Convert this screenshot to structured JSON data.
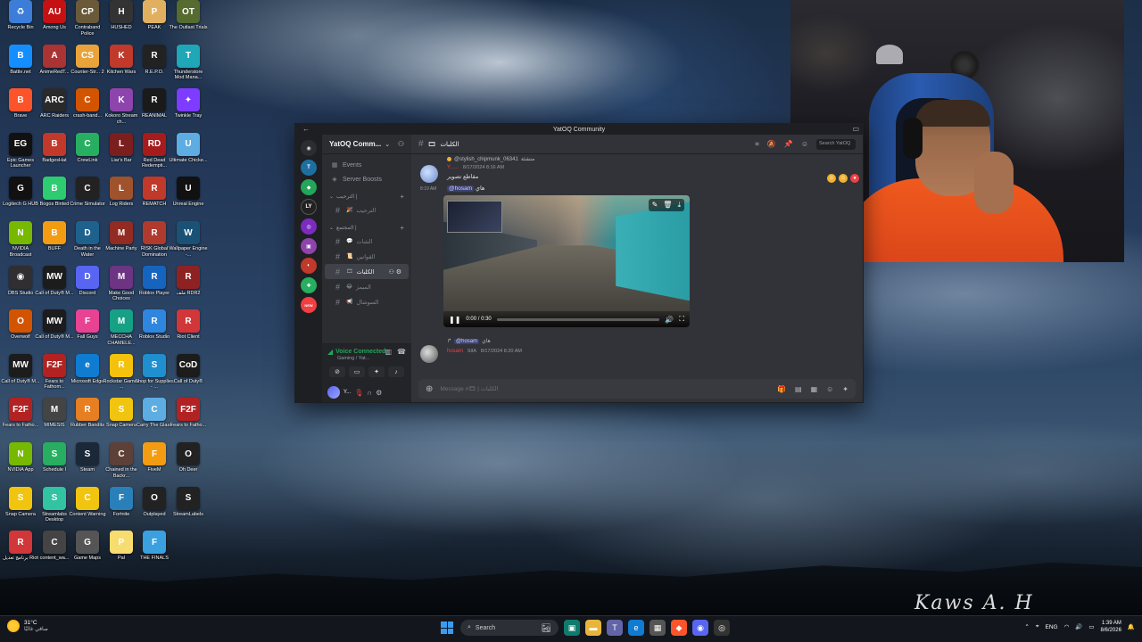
{
  "desktop": {
    "icons": [
      {
        "label": "Recycle Bin",
        "glyph": "♻",
        "color": "#3b7dd8"
      },
      {
        "label": "Among Us",
        "glyph": "AU",
        "color": "#c51111"
      },
      {
        "label": "Contraband Police",
        "glyph": "CP",
        "color": "#6b5a3a"
      },
      {
        "label": "HUSHED",
        "glyph": "H",
        "color": "#333333"
      },
      {
        "label": "PEAK",
        "glyph": "P",
        "color": "#e0b060"
      },
      {
        "label": "The Outlast Trials",
        "glyph": "OT",
        "color": "#556b2f"
      },
      {
        "label": "Battle.net",
        "glyph": "B",
        "color": "#148eff"
      },
      {
        "label": "AnimeRedT...",
        "glyph": "A",
        "color": "#aa3333"
      },
      {
        "label": "Counter-Str... 2",
        "glyph": "CS",
        "color": "#e8a33b"
      },
      {
        "label": "Kitchen Wars",
        "glyph": "K",
        "color": "#c0392b"
      },
      {
        "label": "R.E.P.O.",
        "glyph": "R",
        "color": "#222222"
      },
      {
        "label": "Thunderstore Mod Mana...",
        "glyph": "T",
        "color": "#1fa7b8"
      },
      {
        "label": "Brave",
        "glyph": "B",
        "color": "#fb542b"
      },
      {
        "label": "ARC Raiders",
        "glyph": "ARC",
        "color": "#2a2a2a"
      },
      {
        "label": "crash-band...",
        "glyph": "C",
        "color": "#d35400"
      },
      {
        "label": "Kokoro Stream ch...",
        "glyph": "K",
        "color": "#8e44ad"
      },
      {
        "label": "REANIMAL",
        "glyph": "R",
        "color": "#1a1a1a"
      },
      {
        "label": "Twinkle Tray",
        "glyph": "✦",
        "color": "#7d3cff"
      },
      {
        "label": "Epic Games Launcher",
        "glyph": "EG",
        "color": "#111111"
      },
      {
        "label": "BadgesHat",
        "glyph": "B",
        "color": "#c0392b"
      },
      {
        "label": "CrewLink",
        "glyph": "C",
        "color": "#27ae60"
      },
      {
        "label": "Liar's Bar",
        "glyph": "L",
        "color": "#7b1e1e"
      },
      {
        "label": "Red Dead Redempti...",
        "glyph": "RD",
        "color": "#a61b1b"
      },
      {
        "label": "Ultimate Chicke...",
        "glyph": "U",
        "color": "#5dade2"
      },
      {
        "label": "Logitech G HUB",
        "glyph": "G",
        "color": "#111111"
      },
      {
        "label": "Bogos Binted",
        "glyph": "B",
        "color": "#2ecc71"
      },
      {
        "label": "Crime Simulator",
        "glyph": "C",
        "color": "#222222"
      },
      {
        "label": "Log Riders",
        "glyph": "L",
        "color": "#a0522d"
      },
      {
        "label": "REMATCH",
        "glyph": "R",
        "color": "#c0392b"
      },
      {
        "label": "Unreal Engine",
        "glyph": "U",
        "color": "#111111"
      },
      {
        "label": "NVIDIA Broadcast",
        "glyph": "N",
        "color": "#76b900"
      },
      {
        "label": "BUFF",
        "glyph": "B",
        "color": "#f39c12"
      },
      {
        "label": "Death in the Water",
        "glyph": "D",
        "color": "#1f618d"
      },
      {
        "label": "Machine Party",
        "glyph": "M",
        "color": "#922b21"
      },
      {
        "label": "RISK Global Domination",
        "glyph": "R",
        "color": "#b03a2e"
      },
      {
        "label": "Wallpaper Engine -...",
        "glyph": "W",
        "color": "#1a5276"
      },
      {
        "label": "OBS Studio",
        "glyph": "◉",
        "color": "#302e31"
      },
      {
        "label": "Call of Duty® M...",
        "glyph": "MW",
        "color": "#1c1c1c"
      },
      {
        "label": "Discord",
        "glyph": "D",
        "color": "#5865f2"
      },
      {
        "label": "Make Good Choices",
        "glyph": "M",
        "color": "#6c3483"
      },
      {
        "label": "Roblox Player",
        "glyph": "R",
        "color": "#1565c0"
      },
      {
        "label": "ملف RDR2",
        "glyph": "R",
        "color": "#8e2222"
      },
      {
        "label": "Overwolf",
        "glyph": "O",
        "color": "#d35400"
      },
      {
        "label": "Call of Duty® M...",
        "glyph": "MW",
        "color": "#1c1c1c"
      },
      {
        "label": "Fall Guys",
        "glyph": "F",
        "color": "#e84393"
      },
      {
        "label": "MECCHA CHAMELE...",
        "glyph": "M",
        "color": "#16a085"
      },
      {
        "label": "Roblox Studio",
        "glyph": "R",
        "color": "#2e86de"
      },
      {
        "label": "Riot Client",
        "glyph": "R",
        "color": "#d13639"
      },
      {
        "label": "Call of Duty® M...",
        "glyph": "MW",
        "color": "#1c1c1c"
      },
      {
        "label": "Fears to Fathom...",
        "glyph": "F2F",
        "color": "#b22222"
      },
      {
        "label": "Microsoft Edge",
        "glyph": "e",
        "color": "#0f7bd1"
      },
      {
        "label": "Rockstar Games ...",
        "glyph": "R",
        "color": "#f4c20d"
      },
      {
        "label": "Shop for Supplies - ...",
        "glyph": "S",
        "color": "#1f8fcf"
      },
      {
        "label": "Call of Duty®",
        "glyph": "CoD",
        "color": "#1c1c1c"
      },
      {
        "label": "Fears to Fatho...",
        "glyph": "F2F",
        "color": "#b22222"
      },
      {
        "label": "MIMESIS",
        "glyph": "M",
        "color": "#444444"
      },
      {
        "label": "Rubber Bandits",
        "glyph": "R",
        "color": "#e67e22"
      },
      {
        "label": "Snap Camera",
        "glyph": "S",
        "color": "#f1c40f"
      },
      {
        "label": "Carry The Glass",
        "glyph": "C",
        "color": "#5dade2"
      },
      {
        "label": "Fears to Fatho...",
        "glyph": "F2F",
        "color": "#b22222"
      },
      {
        "label": "NVIDIA App",
        "glyph": "N",
        "color": "#76b900"
      },
      {
        "label": "Schedule I",
        "glyph": "S",
        "color": "#27ae60"
      },
      {
        "label": "Steam",
        "glyph": "S",
        "color": "#1b2838"
      },
      {
        "label": "Chained in the Backr...",
        "glyph": "C",
        "color": "#5d4037"
      },
      {
        "label": "FiveM",
        "glyph": "F",
        "color": "#f39c12"
      },
      {
        "label": "Oh Deer",
        "glyph": "O",
        "color": "#222222"
      },
      {
        "label": "Snap Camera",
        "glyph": "S",
        "color": "#f1c40f"
      },
      {
        "label": "Streamlabs Desktop",
        "glyph": "S",
        "color": "#31c3a2"
      },
      {
        "label": "Content Warning",
        "glyph": "C",
        "color": "#f1c40f"
      },
      {
        "label": "Fortnite",
        "glyph": "F",
        "color": "#2980b9"
      },
      {
        "label": "Outplayed",
        "glyph": "O",
        "color": "#222222"
      },
      {
        "label": "StreamLabels",
        "glyph": "S",
        "color": "#222222"
      },
      {
        "label": "برنامج تعديل Riot",
        "glyph": "R",
        "color": "#d13639"
      },
      {
        "label": "content_wa...",
        "glyph": "C",
        "color": "#444444"
      },
      {
        "label": "Game Maps",
        "glyph": "G",
        "color": "#555555"
      },
      {
        "label": "Pal",
        "glyph": "P",
        "color": "#f7dc6f"
      },
      {
        "label": "THE FINALS",
        "glyph": "F",
        "color": "#3aa0e0"
      }
    ],
    "signature": "Kaws A. H"
  },
  "discord": {
    "window_title": "YatOQ Community",
    "server_name": "YatOQ Comm...",
    "events_label": "Events",
    "boosts_label": "Server Boosts",
    "categories": [
      {
        "label": "الترحيب |"
      },
      {
        "label": "المجتمع |"
      }
    ],
    "pre_channels": [
      {
        "emoji": "🎉",
        "name": "الترحيب"
      }
    ],
    "channels": [
      {
        "emoji": "💬",
        "name": "الشات",
        "active": false
      },
      {
        "emoji": "📜",
        "name": "القوانين",
        "active": false
      },
      {
        "emoji": "🎞",
        "name": "الكلبات",
        "active": true
      },
      {
        "emoji": "😂",
        "name": "الميمز",
        "active": false
      },
      {
        "emoji": "📢",
        "name": "السوشال",
        "active": false
      }
    ],
    "voice": {
      "title": "Voice Connected",
      "subtitle": "Gaming / Yat..."
    },
    "user": {
      "name": "Y..."
    },
    "channel_header": "الكلبات",
    "search_placeholder": "Search YatOQ",
    "messages": {
      "reply_user": "@stylish_chipmunk_06341",
      "reply_text": "منشئة",
      "msg1_author": "Y......",
      "msg1_time": "8/17/2024 8:16 AM",
      "msg1_text": "مقاطع تصوير",
      "msg2_time": "8:19 AM",
      "msg2_mention": "@hosam",
      "msg2_text": "هاي",
      "video_time": "0:00 / 0:30",
      "video_progress": 0,
      "msg3_reply_mention": "@hosam",
      "msg3_reply_text": "هاي",
      "msg3_author": "hosam",
      "msg3_tag": "SIIA",
      "msg3_time": "8/17/2024 8:20 AM"
    },
    "composer_placeholder": "Message #🎞 | الكلبات"
  },
  "taskbar": {
    "temperature": "31°C",
    "condition": "صافي غالبًا",
    "search_label": "Search",
    "language": "ENG",
    "time": "1:39 AM",
    "date": "8/6/2026"
  }
}
